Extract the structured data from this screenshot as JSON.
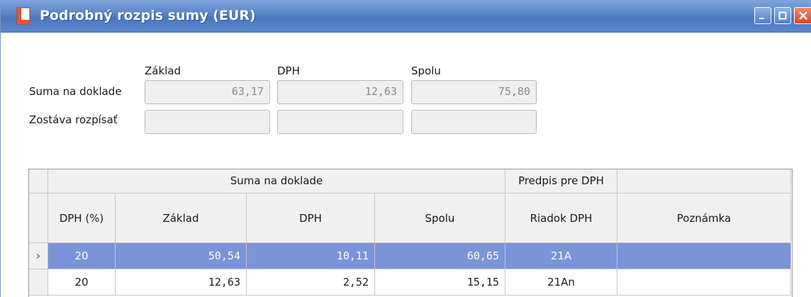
{
  "window": {
    "title": "Podrobný rozpis sumy (EUR)",
    "titlebar_color": "#5883c8",
    "icons": [
      "document-icon",
      "minimize-icon",
      "maximize-icon",
      "close-icon"
    ]
  },
  "summary": {
    "col_headers": [
      "Základ",
      "DPH",
      "Spolu"
    ],
    "rows": [
      {
        "label": "Suma na doklade",
        "values": [
          "63,17",
          "12,63",
          "75,80"
        ]
      },
      {
        "label": "Zostáva rozpísať",
        "values": [
          "",
          "",
          ""
        ]
      }
    ]
  },
  "grid": {
    "group_headers": [
      "Suma na doklade",
      "Predpis pre DPH",
      ""
    ],
    "columns": [
      "DPH (%)",
      "Základ",
      "DPH",
      "Spolu",
      "Riadok DPH",
      "Poznámka"
    ],
    "rows": [
      {
        "selected": true,
        "cells": [
          "20",
          "50,54",
          "10,11",
          "60,65",
          "21A",
          ""
        ]
      },
      {
        "selected": false,
        "cells": [
          "20",
          "12,63",
          "2,52",
          "15,15",
          "21An",
          ""
        ]
      }
    ],
    "selection_color": "#7b93d8",
    "row_indicator": "›"
  }
}
